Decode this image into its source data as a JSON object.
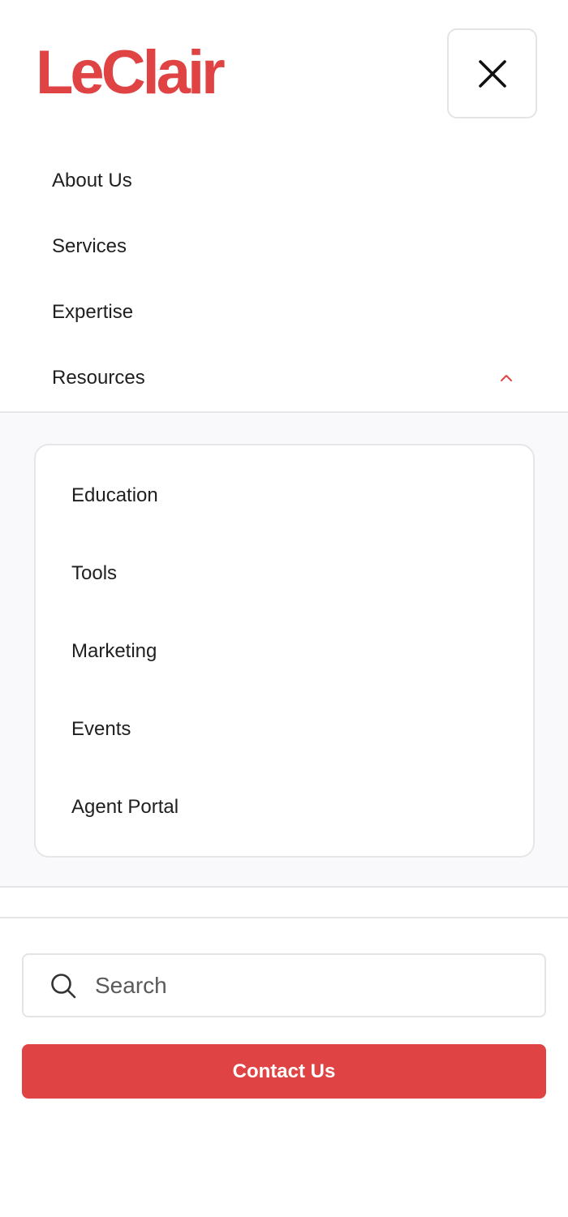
{
  "header": {
    "logo_text": "LeClair",
    "close_icon": "close-icon"
  },
  "nav": {
    "items": [
      {
        "label": "About Us"
      },
      {
        "label": "Services"
      },
      {
        "label": "Expertise"
      },
      {
        "label": "Resources",
        "expanded": true,
        "icon": "chevron-up-icon"
      }
    ]
  },
  "resources_submenu": {
    "items": [
      {
        "label": "Education"
      },
      {
        "label": "Tools"
      },
      {
        "label": "Marketing"
      },
      {
        "label": "Events"
      },
      {
        "label": "Agent Portal"
      }
    ]
  },
  "search": {
    "placeholder": "Search",
    "value": "",
    "icon": "search-icon"
  },
  "contact": {
    "label": "Contact Us"
  },
  "colors": {
    "brand": "#e04343",
    "submenu_bg": "#f9f8fb",
    "border": "#e6e6e8",
    "text": "#1f1f1f"
  }
}
